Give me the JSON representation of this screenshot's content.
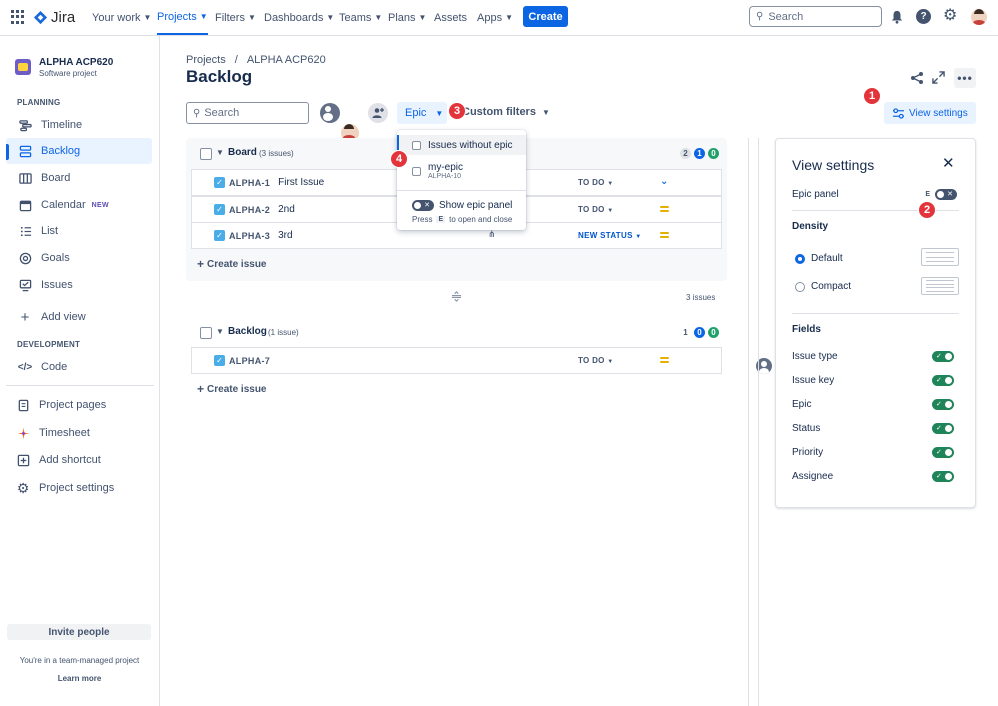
{
  "topbar": {
    "brand": "Jira",
    "nav": [
      "Your work",
      "Projects",
      "Filters",
      "Dashboards",
      "Teams",
      "Plans",
      "Assets",
      "Apps"
    ],
    "create_label": "Create",
    "search_placeholder": "Search"
  },
  "sidebar": {
    "project_name": "ALPHA ACP620",
    "project_type": "Software project",
    "planning_heading": "PLANNING",
    "planning_items": [
      "Timeline",
      "Backlog",
      "Board",
      "Calendar",
      "List",
      "Goals",
      "Issues"
    ],
    "calendar_badge": "NEW",
    "add_view": "Add view",
    "development_heading": "DEVELOPMENT",
    "code": "Code",
    "project_pages": "Project pages",
    "timesheet": "Timesheet",
    "add_shortcut": "Add shortcut",
    "project_settings": "Project settings",
    "invite_people": "Invite people",
    "team_managed_note": "You're in a team-managed project",
    "learn_more": "Learn more"
  },
  "breadcrumb": {
    "root": "Projects",
    "separator": "/",
    "project": "ALPHA ACP620"
  },
  "page_title": "Backlog",
  "toolbar": {
    "search_placeholder": "Search",
    "epic_label": "Epic",
    "custom_filters": "Custom filters",
    "view_settings": "View settings"
  },
  "epic_dropdown": {
    "issues_without_epic": "Issues without epic",
    "epic_name": "my-epic",
    "epic_key": "ALPHA-10",
    "show_epic_panel": "Show epic panel",
    "hint_press": "Press",
    "hint_key": "E",
    "hint_rest": "to open and close"
  },
  "board_section": {
    "title": "Board",
    "count": "(3 issues)",
    "badges": [
      "2",
      "1",
      "0"
    ],
    "issues": [
      {
        "key": "ALPHA-1",
        "summary": "First Issue",
        "status": "TO DO",
        "priority": "low",
        "assignee": "unassigned"
      },
      {
        "key": "ALPHA-2",
        "summary": "2nd",
        "status": "TO DO",
        "priority": "medium",
        "assignee": "user"
      },
      {
        "key": "ALPHA-3",
        "summary": "3rd",
        "status": "NEW STATUS",
        "priority": "medium",
        "assignee": "unassigned"
      }
    ],
    "create_issue": "Create issue",
    "total": "3 issues"
  },
  "backlog_section": {
    "title": "Backlog",
    "count": "(1 issue)",
    "badges": [
      "1",
      "0",
      "0"
    ],
    "issues": [
      {
        "key": "ALPHA-7",
        "summary": "",
        "status": "TO DO",
        "priority": "medium",
        "assignee": "unassigned"
      }
    ],
    "create_issue": "Create issue"
  },
  "view_settings_panel": {
    "title": "View settings",
    "epic_panel_label": "Epic panel",
    "epic_panel_shortcut": "E",
    "density_heading": "Density",
    "density_options": [
      "Default",
      "Compact"
    ],
    "density_selected": "Default",
    "fields_heading": "Fields",
    "fields": [
      "Issue type",
      "Issue key",
      "Epic",
      "Status",
      "Priority",
      "Assignee"
    ]
  },
  "markers": [
    "1",
    "2",
    "3",
    "4"
  ],
  "colors": {
    "accent": "#0c66e4",
    "marker": "#e2343a",
    "toggle_on": "#1f845a"
  }
}
